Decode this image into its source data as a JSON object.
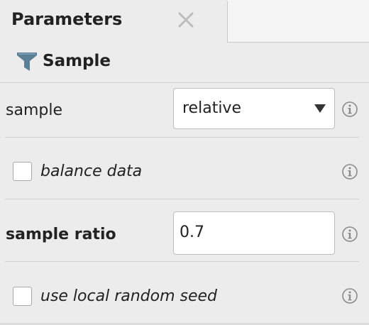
{
  "panel": {
    "tab_title": "Parameters",
    "close_icon": "close-icon"
  },
  "operator": {
    "name": "Sample",
    "icon": "filter-icon"
  },
  "params": {
    "sample": {
      "label": "sample",
      "value": "relative"
    },
    "balance_data": {
      "label": "balance data",
      "checked": false
    },
    "sample_ratio": {
      "label": "sample ratio",
      "value": "0.7"
    },
    "use_local_random_seed": {
      "label": "use local random seed",
      "checked": false
    }
  },
  "colors": {
    "background": "#ececec",
    "text": "#222222",
    "filter_icon": "#5b7f95"
  }
}
